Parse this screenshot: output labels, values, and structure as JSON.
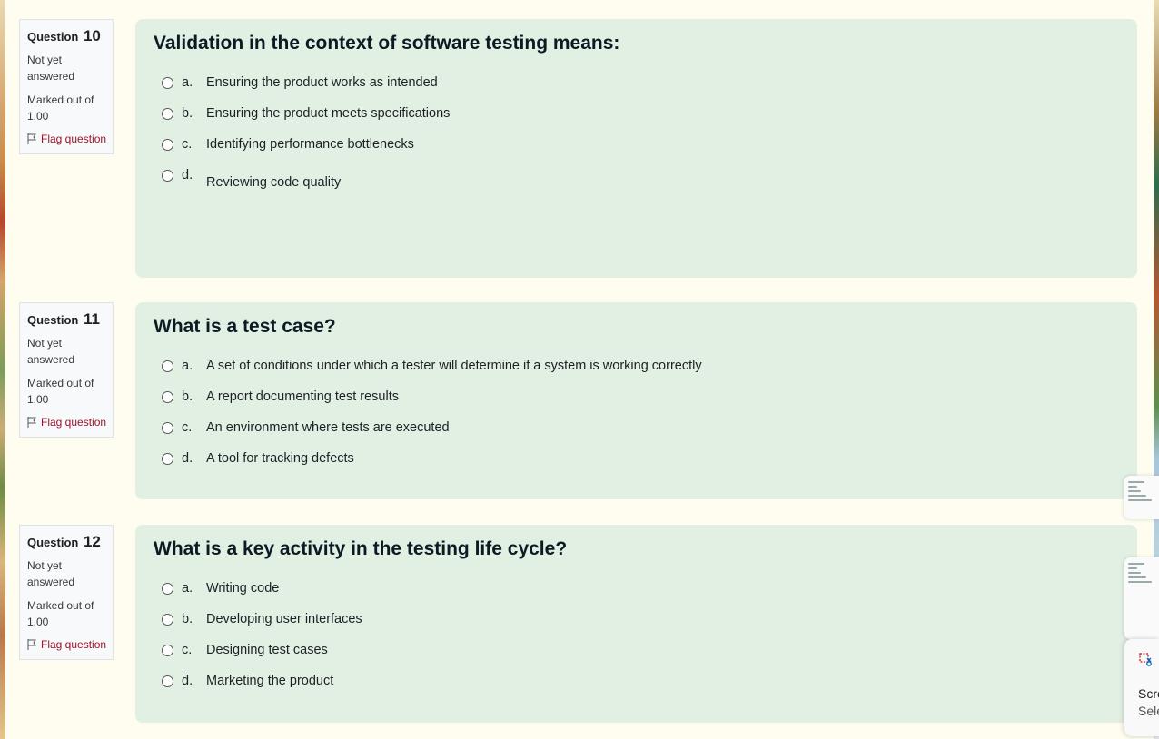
{
  "questions": [
    {
      "label": "Question",
      "number": "10",
      "state": "Not yet answered",
      "grade": "Marked out of 1.00",
      "flag_label": "Flag question",
      "text": "Validation in the context of software testing means:",
      "answers": [
        {
          "letter": "a.",
          "text": "Ensuring the product works as intended"
        },
        {
          "letter": "b.",
          "text": "Ensuring the product meets specifications"
        },
        {
          "letter": "c.",
          "text": "Identifying performance bottlenecks"
        },
        {
          "letter": "d.",
          "text": "Reviewing code quality"
        }
      ]
    },
    {
      "label": "Question",
      "number": "11",
      "state": "Not yet answered",
      "grade": "Marked out of 1.00",
      "flag_label": "Flag question",
      "text": "What is a test case?",
      "answers": [
        {
          "letter": "a.",
          "text": "A set of conditions under which a tester will determine if a system is working correctly"
        },
        {
          "letter": "b.",
          "text": "A report documenting test results"
        },
        {
          "letter": "c.",
          "text": "An environment where tests are executed"
        },
        {
          "letter": "d.",
          "text": "A tool for tracking defects"
        }
      ]
    },
    {
      "label": "Question",
      "number": "12",
      "state": "Not yet answered",
      "grade": "Marked out of 1.00",
      "flag_label": "Flag question",
      "text": "What is a key activity in the testing life cycle?",
      "answers": [
        {
          "letter": "a.",
          "text": "Writing code"
        },
        {
          "letter": "b.",
          "text": "Developing user interfaces"
        },
        {
          "letter": "c.",
          "text": "Designing test cases"
        },
        {
          "letter": "d.",
          "text": "Marketing the product"
        }
      ]
    }
  ],
  "snip_popup": {
    "title": "Scre",
    "subtitle": "Sele",
    "icon": "snipping-tool-icon"
  },
  "colors": {
    "page_bg": "#fefdf0",
    "question_bg": "#e2efe3",
    "flag": "#a0122b"
  }
}
